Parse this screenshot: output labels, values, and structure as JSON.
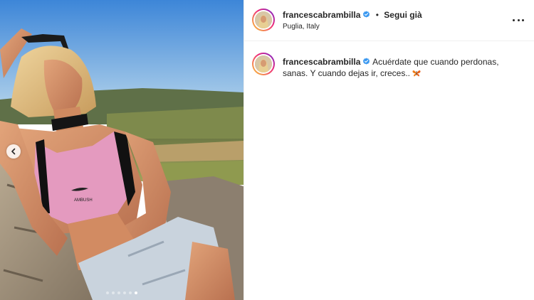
{
  "post": {
    "username": "francescabrambilla",
    "separator": "•",
    "follow_label": "Segui già",
    "location": "Puglia, Italy",
    "verified_icon": "verified-badge-icon",
    "more_icon": "more-options-icon",
    "accent_color": "#3897f0"
  },
  "carousel": {
    "prev_icon": "chevron-left-icon",
    "image_count": 6,
    "active_index": 5
  },
  "comment": {
    "username": "francescabrambilla",
    "text": "Acuérdate que cuando perdonas, sanas. Y cuando dejas ir, creces..",
    "emoji": "butterfly-emoji"
  }
}
